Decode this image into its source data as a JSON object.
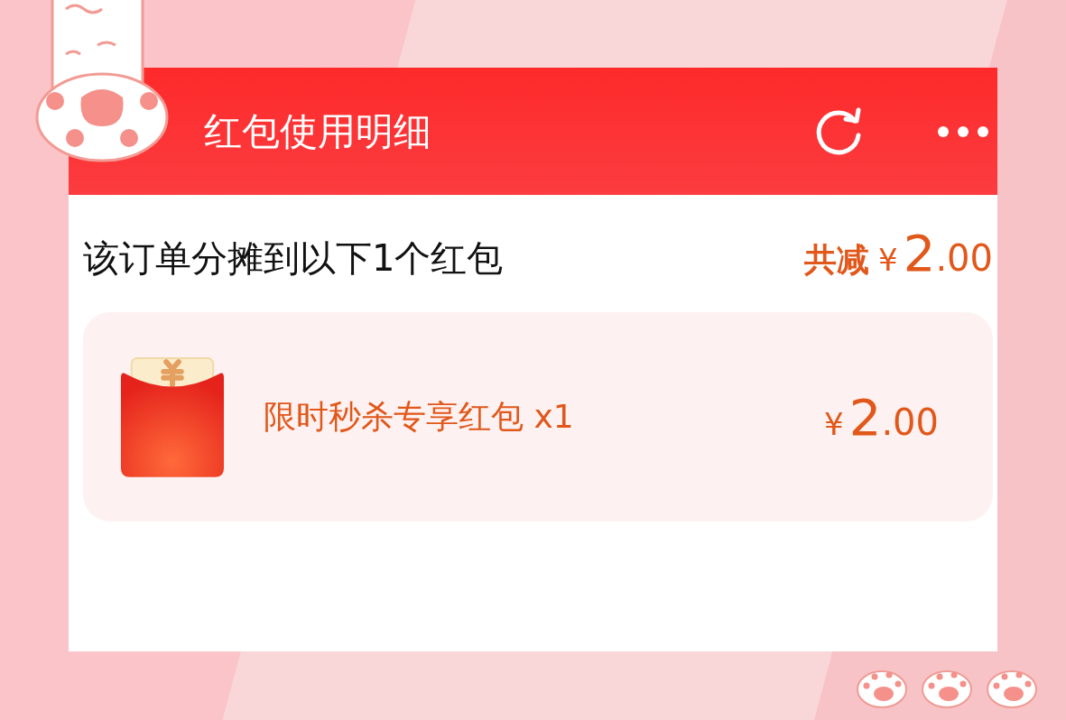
{
  "header": {
    "title": "红包使用明细"
  },
  "summary": {
    "text": "该订单分摊到以下1个红包",
    "total_label": "共减",
    "total": {
      "currency": "¥",
      "integer": "2",
      "decimal": ".00"
    }
  },
  "packets": [
    {
      "name": "限时秒杀专享红包 x1",
      "amount": {
        "currency": "¥",
        "integer": "2",
        "decimal": ".00"
      }
    }
  ]
}
